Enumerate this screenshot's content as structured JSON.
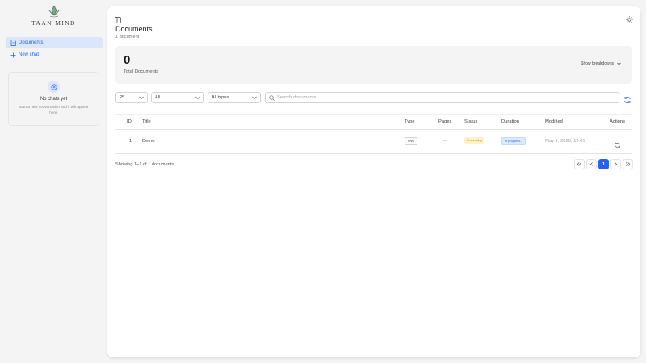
{
  "app": {
    "logo_text": "TAAN MIND"
  },
  "sidebar": {
    "items": [
      {
        "label": "Documents",
        "icon": "document-icon"
      },
      {
        "label": "New chat",
        "icon": "plus-icon"
      }
    ],
    "empty": {
      "title": "No chats yet",
      "subtitle": "Start a new conversation and it will appear here."
    }
  },
  "main": {
    "title": "Documents",
    "subtitle": "1 document",
    "stats": {
      "total_value": "0",
      "total_label": "Total Documents",
      "breakdown_label": "Show breakdowns"
    },
    "filters": {
      "page_size": "25",
      "status": "All",
      "type": "All types",
      "search_placeholder": "Search documents..."
    },
    "table": {
      "columns": [
        "ID",
        "Title",
        "Type",
        "Pages",
        "Status",
        "Duration",
        "Modified",
        "Actions"
      ],
      "rows": [
        {
          "id": "1",
          "title": "Demo",
          "type": "PNG",
          "pages": "—",
          "status": "Processing",
          "duration": "In progress...",
          "modified": "May 1, 2026, 19:05"
        }
      ]
    },
    "pagination": {
      "showing": "Showing 1–1 of 1 documents",
      "current_page": "1"
    }
  },
  "colors": {
    "accent": "#2563eb",
    "status_processing_bg": "#fef3c7",
    "status_processing_fg": "#d97706"
  }
}
